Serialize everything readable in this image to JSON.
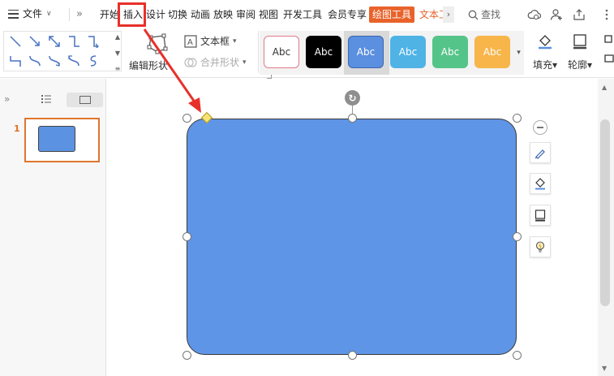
{
  "menubar": {
    "file_label": "文件",
    "more_label": "»",
    "tabs": [
      "开始",
      "插入",
      "设计",
      "切换",
      "动画",
      "放映",
      "审阅",
      "视图",
      "开发工具",
      "会员专享"
    ],
    "active_tool_tab": "绘图工具",
    "text_tool_tab": "文本工",
    "search_label": "查找",
    "highlighted_tab": "插入",
    "accent_color": "#e8622a",
    "highlight_color": "#e8302a"
  },
  "ribbon": {
    "edit_shape_label": "编辑形状",
    "textbox_label": "文本框",
    "merge_shape_label": "合并形状",
    "style_samples": [
      "Abc",
      "Abc",
      "Abc",
      "Abc",
      "Abc",
      "Abc"
    ],
    "style_colors": [
      "#ffffff",
      "#000000",
      "#5b8fdf",
      "#4fb3e6",
      "#55c489",
      "#f7b54a"
    ],
    "fill_label": "填充",
    "outline_label": "轮廓"
  },
  "slides_panel": {
    "slide_number": "1"
  },
  "canvas": {
    "shape_fill": "#5f95e6",
    "shape_type": "rounded-rectangle"
  }
}
